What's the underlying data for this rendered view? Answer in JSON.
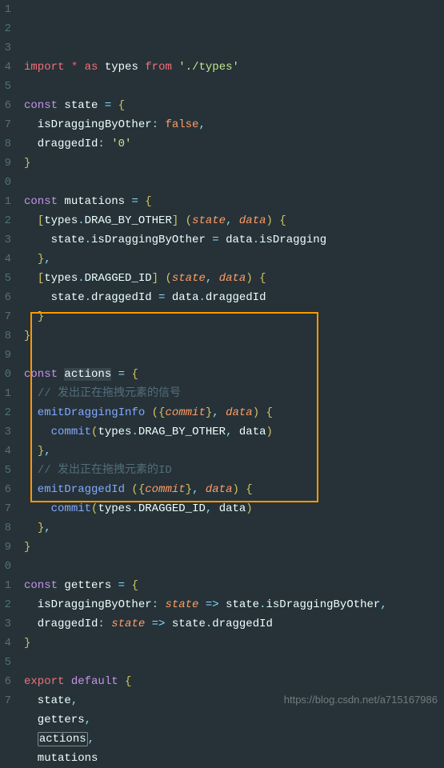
{
  "lineStart": 1,
  "lines": [
    [
      [
        "import ",
        "kw-import"
      ],
      [
        "* ",
        "kw-red"
      ],
      [
        "as ",
        "kw-import"
      ],
      [
        "types ",
        "ident"
      ],
      [
        "from ",
        "kw-import"
      ],
      [
        "'./types'",
        "str"
      ]
    ],
    [],
    [
      [
        "const ",
        "kw-pink"
      ],
      [
        "state ",
        "ident"
      ],
      [
        "= ",
        "punct"
      ],
      [
        "{",
        "paren"
      ]
    ],
    [
      [
        "  isDraggingByOther",
        "prop"
      ],
      [
        ": ",
        "punct"
      ],
      [
        "false",
        "bool"
      ],
      [
        ",",
        "punct"
      ]
    ],
    [
      [
        "  draggedId",
        "prop"
      ],
      [
        ": ",
        "punct"
      ],
      [
        "'0'",
        "str"
      ]
    ],
    [
      [
        "}",
        "paren"
      ]
    ],
    [],
    [
      [
        "const ",
        "kw-pink"
      ],
      [
        "mutations ",
        "ident"
      ],
      [
        "= ",
        "punct"
      ],
      [
        "{",
        "paren"
      ]
    ],
    [
      [
        "  ",
        "ident"
      ],
      [
        "[",
        "paren"
      ],
      [
        "types",
        "ident"
      ],
      [
        ".",
        "punct"
      ],
      [
        "DRAG_BY_OTHER",
        "ident"
      ],
      [
        "]",
        "paren"
      ],
      [
        " (",
        "paren"
      ],
      [
        "state",
        "param"
      ],
      [
        ", ",
        "punct"
      ],
      [
        "data",
        "param"
      ],
      [
        ")",
        "paren"
      ],
      [
        " {",
        "paren"
      ]
    ],
    [
      [
        "    state",
        "ident"
      ],
      [
        ".",
        "punct"
      ],
      [
        "isDraggingByOther ",
        "ident"
      ],
      [
        "= ",
        "punct"
      ],
      [
        "data",
        "ident"
      ],
      [
        ".",
        "punct"
      ],
      [
        "isDragging",
        "ident"
      ]
    ],
    [
      [
        "  ",
        "ident"
      ],
      [
        "}",
        "paren"
      ],
      [
        ",",
        "punct"
      ]
    ],
    [
      [
        "  ",
        "ident"
      ],
      [
        "[",
        "paren"
      ],
      [
        "types",
        "ident"
      ],
      [
        ".",
        "punct"
      ],
      [
        "DRAGGED_ID",
        "ident"
      ],
      [
        "]",
        "paren"
      ],
      [
        " (",
        "paren"
      ],
      [
        "state",
        "param"
      ],
      [
        ", ",
        "punct"
      ],
      [
        "data",
        "param"
      ],
      [
        ")",
        "paren"
      ],
      [
        " {",
        "paren"
      ]
    ],
    [
      [
        "    state",
        "ident"
      ],
      [
        ".",
        "punct"
      ],
      [
        "draggedId ",
        "ident"
      ],
      [
        "= ",
        "punct"
      ],
      [
        "data",
        "ident"
      ],
      [
        ".",
        "punct"
      ],
      [
        "draggedId",
        "ident"
      ]
    ],
    [
      [
        "  ",
        "ident"
      ],
      [
        "}",
        "paren"
      ]
    ],
    [
      [
        "}",
        "paren"
      ]
    ],
    [],
    [
      [
        "const ",
        "kw-pink"
      ],
      [
        "actions",
        "ident hl-word"
      ],
      [
        " ",
        "ident"
      ],
      [
        "= ",
        "punct"
      ],
      [
        "{",
        "paren"
      ]
    ],
    [
      [
        "  ",
        "ident"
      ],
      [
        "// 发出正在拖拽元素的信号",
        "comment"
      ]
    ],
    [
      [
        "  emitDraggingInfo ",
        "var-decl"
      ],
      [
        "(",
        "paren"
      ],
      [
        "{",
        "paren"
      ],
      [
        "commit",
        "param"
      ],
      [
        "}",
        "paren"
      ],
      [
        ", ",
        "punct"
      ],
      [
        "data",
        "param"
      ],
      [
        ")",
        "paren"
      ],
      [
        " {",
        "paren"
      ]
    ],
    [
      [
        "    ",
        "ident"
      ],
      [
        "commit",
        "func-call"
      ],
      [
        "(",
        "paren"
      ],
      [
        "types",
        "ident"
      ],
      [
        ".",
        "punct"
      ],
      [
        "DRAG_BY_OTHER",
        "ident"
      ],
      [
        ", ",
        "punct"
      ],
      [
        "data",
        "ident"
      ],
      [
        ")",
        "paren"
      ]
    ],
    [
      [
        "  ",
        "ident"
      ],
      [
        "}",
        "paren"
      ],
      [
        ",",
        "punct"
      ]
    ],
    [
      [
        "  ",
        "ident"
      ],
      [
        "// 发出正在拖拽元素的ID",
        "comment"
      ]
    ],
    [
      [
        "  emitDraggedId ",
        "var-decl"
      ],
      [
        "(",
        "paren"
      ],
      [
        "{",
        "paren"
      ],
      [
        "commit",
        "param"
      ],
      [
        "}",
        "paren"
      ],
      [
        ", ",
        "punct"
      ],
      [
        "data",
        "param"
      ],
      [
        ")",
        "paren"
      ],
      [
        " {",
        "paren"
      ]
    ],
    [
      [
        "    ",
        "ident"
      ],
      [
        "commit",
        "func-call"
      ],
      [
        "(",
        "paren"
      ],
      [
        "types",
        "ident"
      ],
      [
        ".",
        "punct"
      ],
      [
        "DRAGGED_ID",
        "ident"
      ],
      [
        ", ",
        "punct"
      ],
      [
        "data",
        "ident"
      ],
      [
        ")",
        "paren"
      ]
    ],
    [
      [
        "  ",
        "ident"
      ],
      [
        "}",
        "paren"
      ],
      [
        ",",
        "punct"
      ]
    ],
    [
      [
        "}",
        "paren"
      ]
    ],
    [],
    [
      [
        "const ",
        "kw-pink"
      ],
      [
        "getters ",
        "ident"
      ],
      [
        "= ",
        "punct"
      ],
      [
        "{",
        "paren"
      ]
    ],
    [
      [
        "  isDraggingByOther",
        "prop"
      ],
      [
        ": ",
        "punct"
      ],
      [
        "state",
        "param"
      ],
      [
        " => ",
        "punct"
      ],
      [
        "state",
        "ident"
      ],
      [
        ".",
        "punct"
      ],
      [
        "isDraggingByOther",
        "ident"
      ],
      [
        ",",
        "punct"
      ]
    ],
    [
      [
        "  draggedId",
        "prop"
      ],
      [
        ": ",
        "punct"
      ],
      [
        "state",
        "param"
      ],
      [
        " => ",
        "punct"
      ],
      [
        "state",
        "ident"
      ],
      [
        ".",
        "punct"
      ],
      [
        "draggedId",
        "ident"
      ]
    ],
    [
      [
        "}",
        "paren"
      ]
    ],
    [],
    [
      [
        "export ",
        "kw-import"
      ],
      [
        "default ",
        "kw-pink"
      ],
      [
        "{",
        "paren"
      ]
    ],
    [
      [
        "  state",
        "ident"
      ],
      [
        ",",
        "punct"
      ]
    ],
    [
      [
        "  getters",
        "ident"
      ],
      [
        ",",
        "punct"
      ]
    ],
    [
      [
        "  ",
        "ident"
      ],
      [
        "actions",
        "ident sel-box"
      ],
      [
        ",",
        "punct"
      ]
    ],
    [
      [
        "  mutations",
        "ident"
      ]
    ]
  ],
  "watermark": "https://blog.csdn.net/a715167986"
}
